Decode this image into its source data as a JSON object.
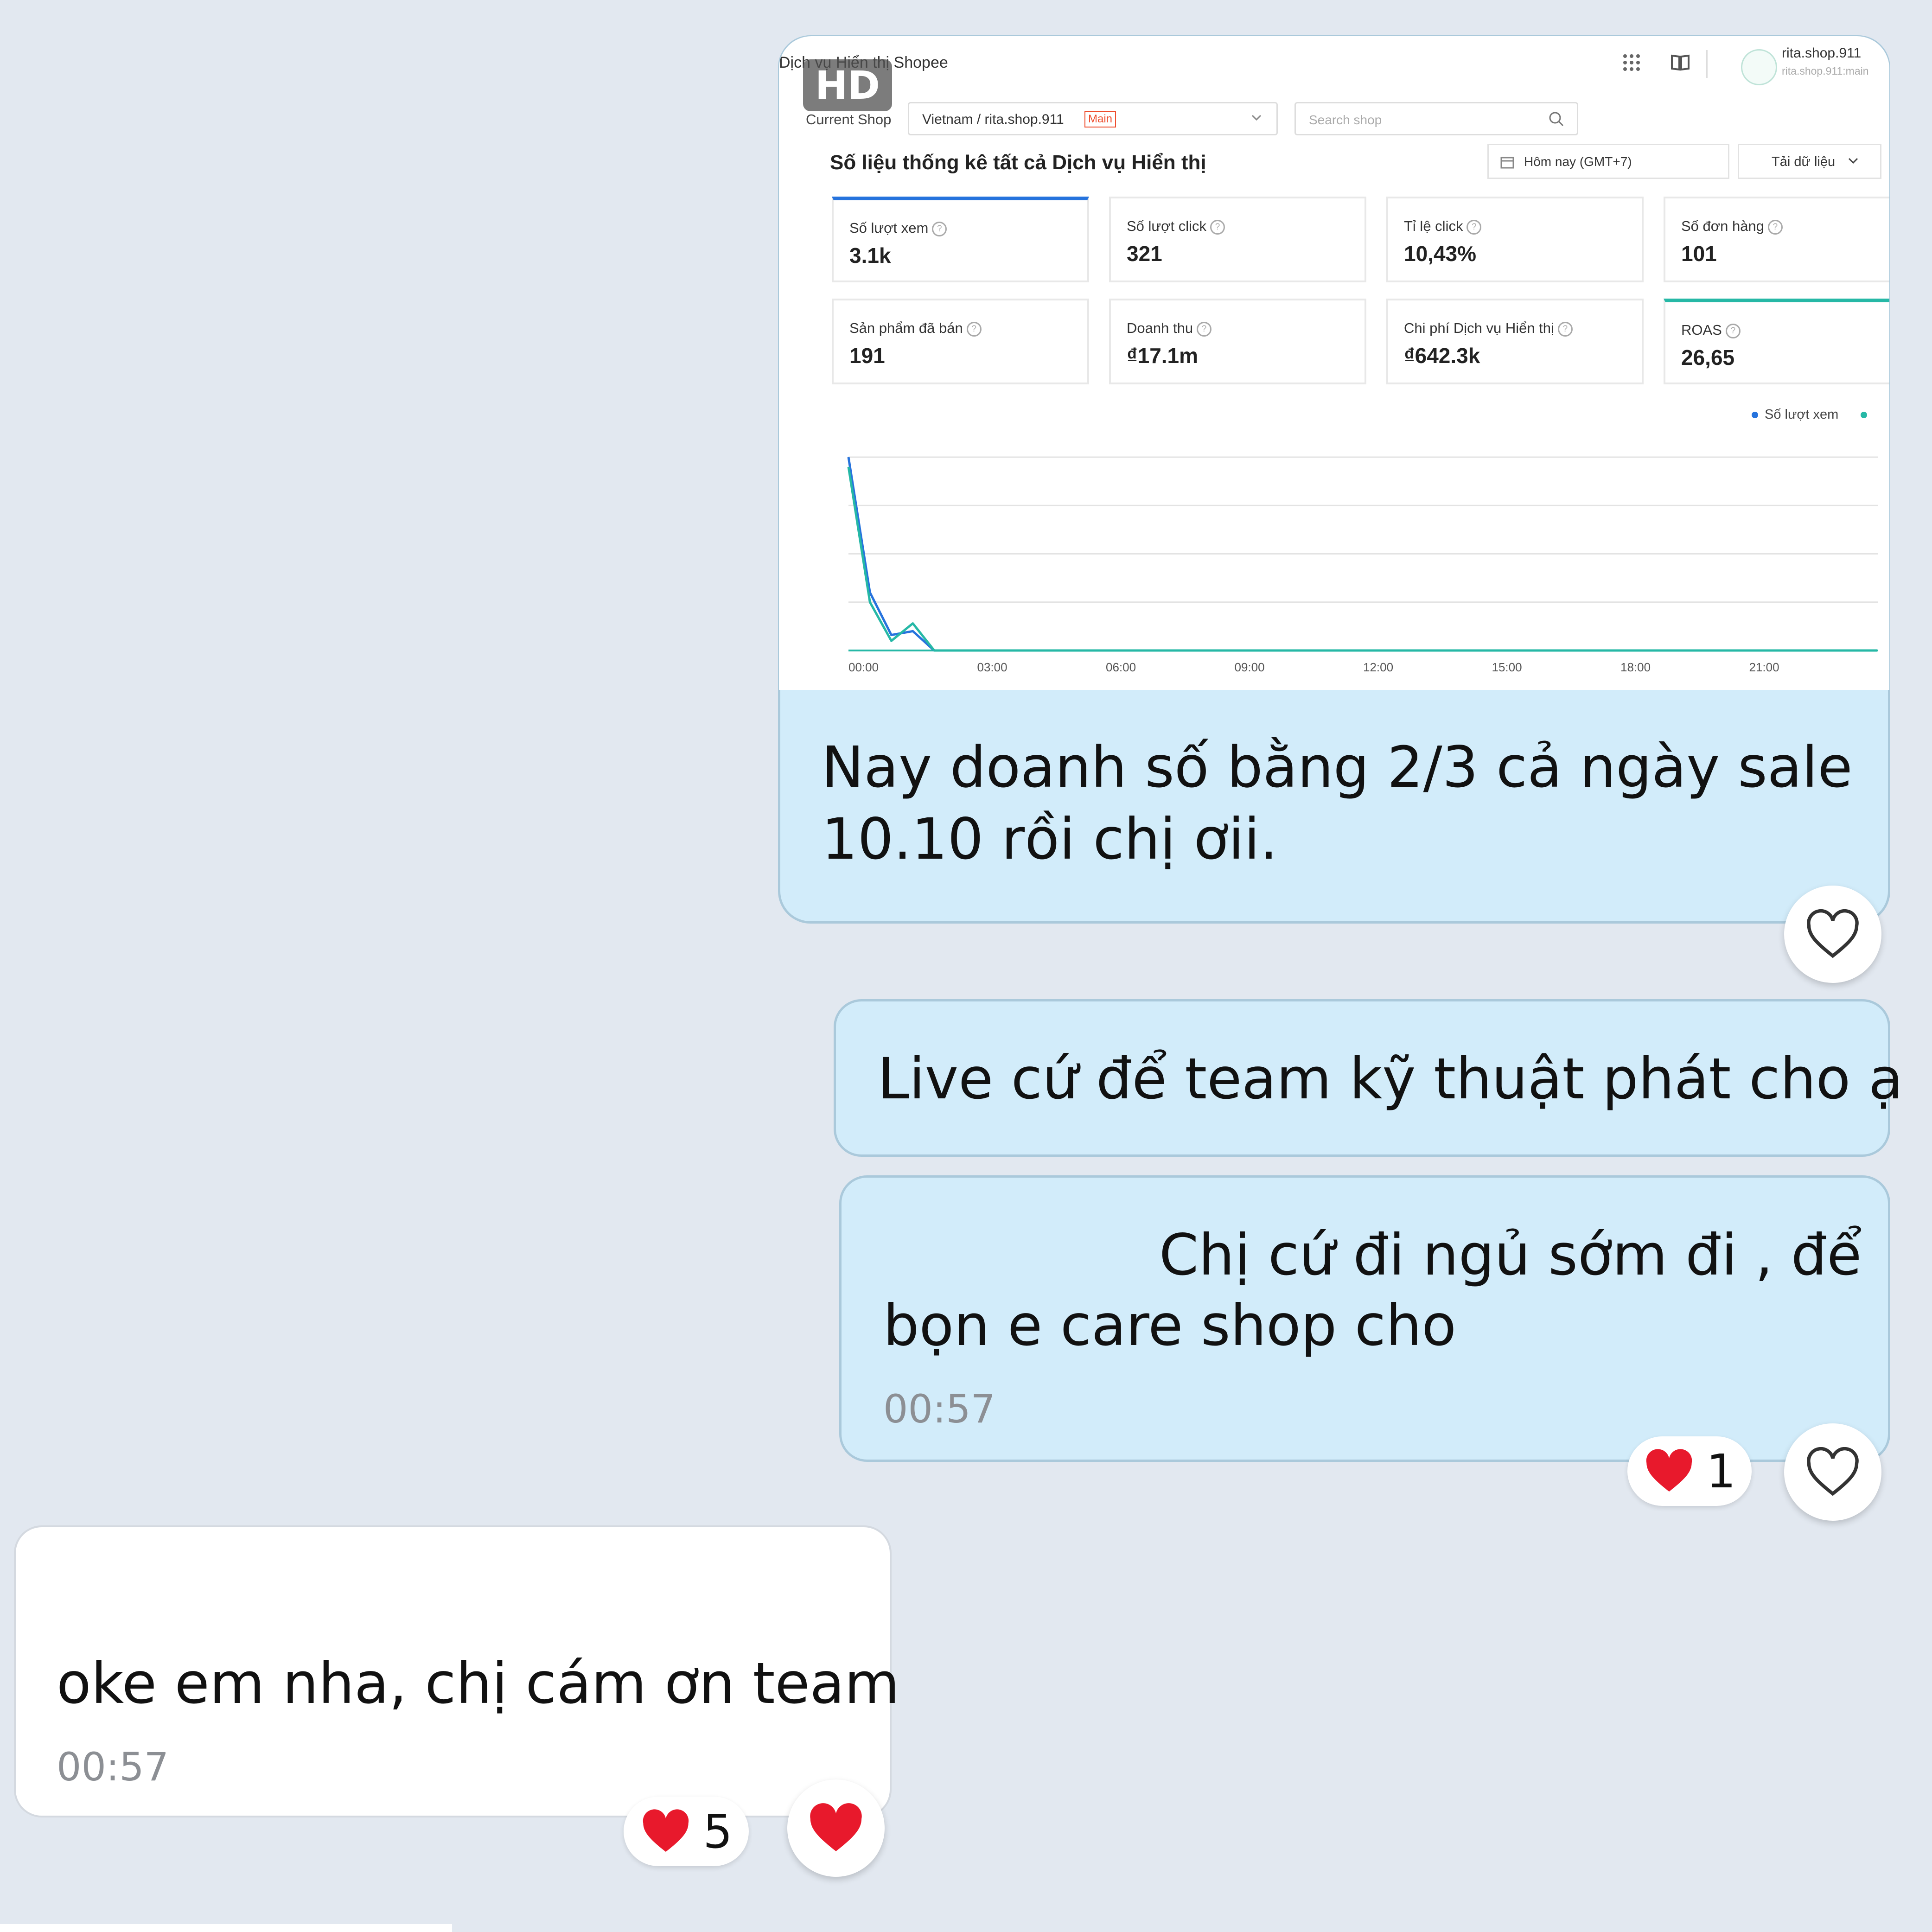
{
  "screenshot": {
    "hd_badge": "HD",
    "app_title": "Dịch vụ Hiển thị Shopee",
    "current_shop_label": "Current Shop",
    "shop_select_value": "Vietnam / rita.shop.911",
    "shop_tag": "Main",
    "search_placeholder": "Search shop",
    "account_name": "rita.shop.911",
    "account_sub": "rita.shop.911:main",
    "section_title": "Số liệu thống kê tất cả Dịch vụ Hiển thị",
    "date_picker": "Hôm nay (GMT+7)",
    "download_label": "Tải dữ liệu",
    "kpis": [
      {
        "label": "Số lượt xem",
        "value": "3.1k"
      },
      {
        "label": "Số lượt click",
        "value": "321"
      },
      {
        "label": "Tỉ lệ click",
        "value": "10,43%"
      },
      {
        "label": "Số đơn hàng",
        "value": "101"
      },
      {
        "label": "Sản phẩm đã bán",
        "value": "191"
      },
      {
        "label": "Doanh thu",
        "value": "₫17.1m"
      },
      {
        "label": "Chi phí Dịch vụ Hiển thị",
        "value": "₫642.3k"
      },
      {
        "label": "ROAS",
        "value": "26,65"
      }
    ],
    "legend": "Số lượt xem",
    "colors": {
      "accent_blue": "#2673dd",
      "accent_teal": "#26b8a6",
      "tag_red": "#ee4d2d"
    }
  },
  "chart_data": {
    "type": "line",
    "x": [
      "00:00",
      "00:30",
      "01:00",
      "01:30",
      "02:00",
      "03:00",
      "06:00",
      "09:00",
      "12:00",
      "15:00",
      "18:00",
      "21:00",
      "23:59"
    ],
    "x_ticks": [
      "00:00",
      "03:00",
      "06:00",
      "09:00",
      "12:00",
      "15:00",
      "18:00",
      "21:00"
    ],
    "series": [
      {
        "name": "Số lượt xem",
        "color": "#2673dd",
        "values": [
          100,
          30,
          8,
          10,
          0,
          0,
          0,
          0,
          0,
          0,
          0,
          0,
          0
        ]
      },
      {
        "color": "#26b8a6",
        "values": [
          95,
          25,
          5,
          14,
          0,
          0,
          0,
          0,
          0,
          0,
          0,
          0,
          0
        ]
      }
    ],
    "ylim": [
      0,
      100
    ],
    "grid": true
  },
  "messages": [
    {
      "type": "outgoing",
      "text": "Nay doanh số bằng 2/3 cả ngày sale 10.10 rồi chị ơii."
    },
    {
      "type": "outgoing",
      "text": "Live cứ để team kỹ thuật phát cho ạ"
    },
    {
      "type": "outgoing",
      "text_line1": "Chị cứ đi ngủ sớm đi , để",
      "text_line2": "bọn e care shop cho",
      "time": "00:57",
      "reaction_count": "1"
    },
    {
      "type": "incoming",
      "text": "oke em nha, chị cám ơn team",
      "time": "00:57",
      "reaction_count": "5"
    }
  ],
  "icons": [
    "heart-outline-icon",
    "heart-filled-icon",
    "grid-icon",
    "book-icon",
    "search-icon",
    "calendar-icon",
    "chevron-down-icon"
  ]
}
